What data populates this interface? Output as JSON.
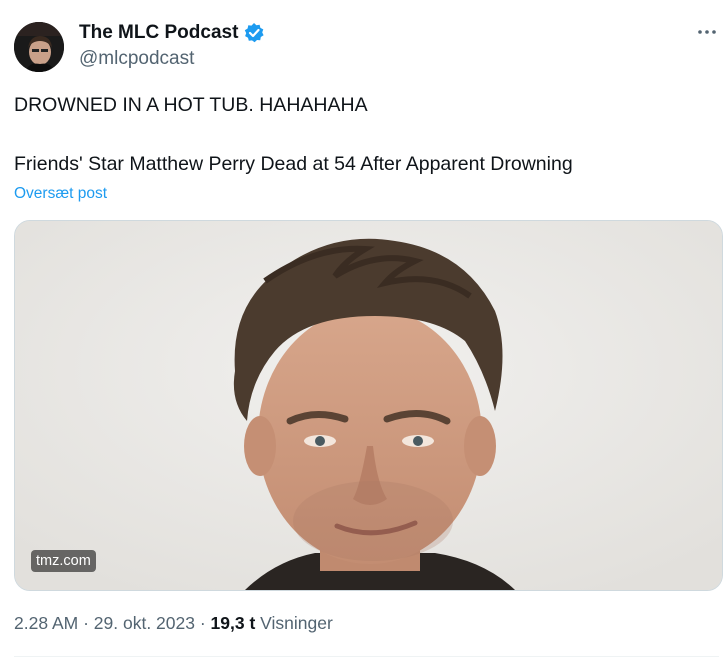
{
  "author": {
    "display_name": "The MLC Podcast",
    "handle": "@mlcpodcast",
    "verified": true
  },
  "tweet": {
    "line1": "DROWNED IN A HOT TUB. HAHAHAHA",
    "line2": "Friends' Star Matthew Perry Dead at 54 After Apparent Drowning",
    "translate_label": "Oversæt post"
  },
  "card": {
    "source": "tmz.com",
    "image_subject": "portrait photo of Matthew Perry"
  },
  "meta": {
    "time": "2.28 AM",
    "separator1": " · ",
    "date": "29. okt. 2023",
    "separator2": " · ",
    "views_count": "19,3 t",
    "views_label": " Visninger"
  },
  "colors": {
    "accent": "#1d9bf0",
    "text_primary": "#0f1419",
    "text_secondary": "#536471",
    "border": "#cfd9de"
  },
  "icons": {
    "verified": "verified-badge-icon",
    "more": "more-options-icon"
  }
}
